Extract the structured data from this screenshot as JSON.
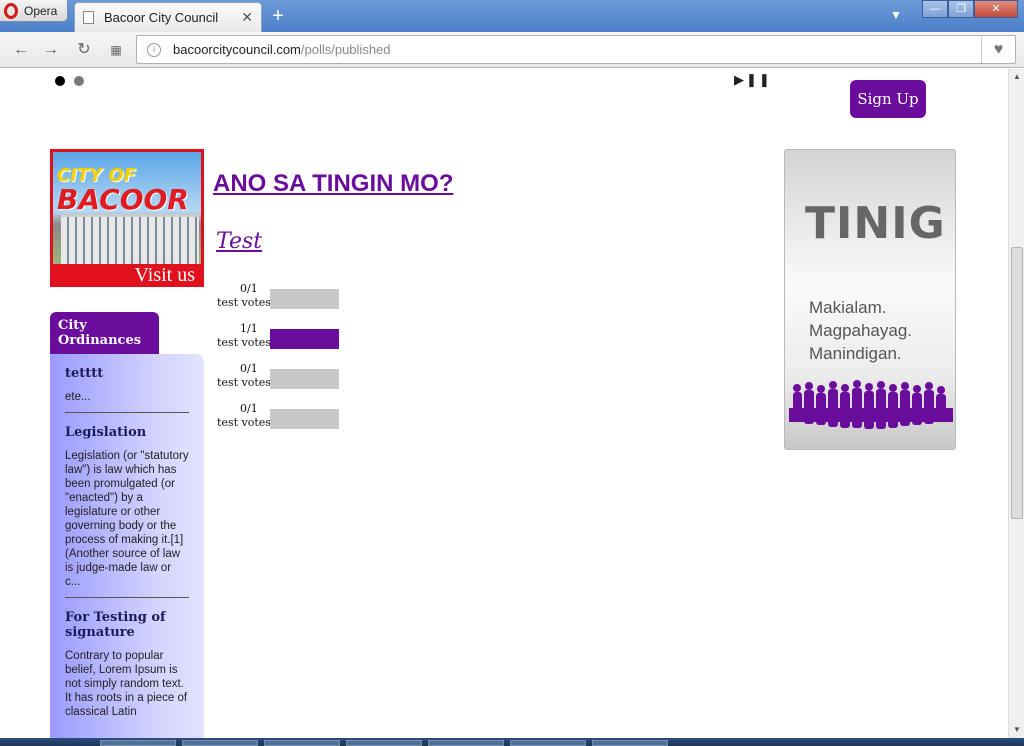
{
  "browser": {
    "app_name": "Opera",
    "tab_title": "Bacoor City Council",
    "url_domain": "bacoorcitycouncil.com",
    "url_path": "/polls/published",
    "new_tab": "+",
    "close_tab": "✕"
  },
  "header": {
    "signup_label": "Sign Up"
  },
  "banner": {
    "title_top": "CITY OF",
    "title_main": "BACOOR",
    "visit_label": "Visit us"
  },
  "sidebar": {
    "tab_label": "City Ordinances",
    "items": [
      {
        "title": "tetttt",
        "body": "ete..."
      },
      {
        "title": "Legislation",
        "body": "Legislation (or \"statutory law\") is law which has been promulgated (or \"enacted\") by a legislature or other governing body or the process of making it.[1] (Another source of law is judge-made law or c..."
      },
      {
        "title": "For Testing of signature",
        "body": "Contrary to popular belief, Lorem Ipsum is not simply random text. It has roots in a piece of classical Latin"
      }
    ]
  },
  "poll": {
    "heading": "ANO SA TINGIN MO?",
    "name": "Test",
    "options": [
      {
        "count": "0/1",
        "label": "test votes",
        "fraction": 0
      },
      {
        "count": "1/1",
        "label": "test votes",
        "fraction": 1
      },
      {
        "count": "0/1",
        "label": "test votes",
        "fraction": 0
      },
      {
        "count": "0/1",
        "label": "test votes",
        "fraction": 0
      }
    ]
  },
  "tinig": {
    "title": "TINIG",
    "lines": [
      "Makialam.",
      "Magpahayag.",
      "Manindigan."
    ]
  },
  "colors": {
    "accent": "#6b0d9c",
    "bar_empty": "#c8c8c8"
  }
}
